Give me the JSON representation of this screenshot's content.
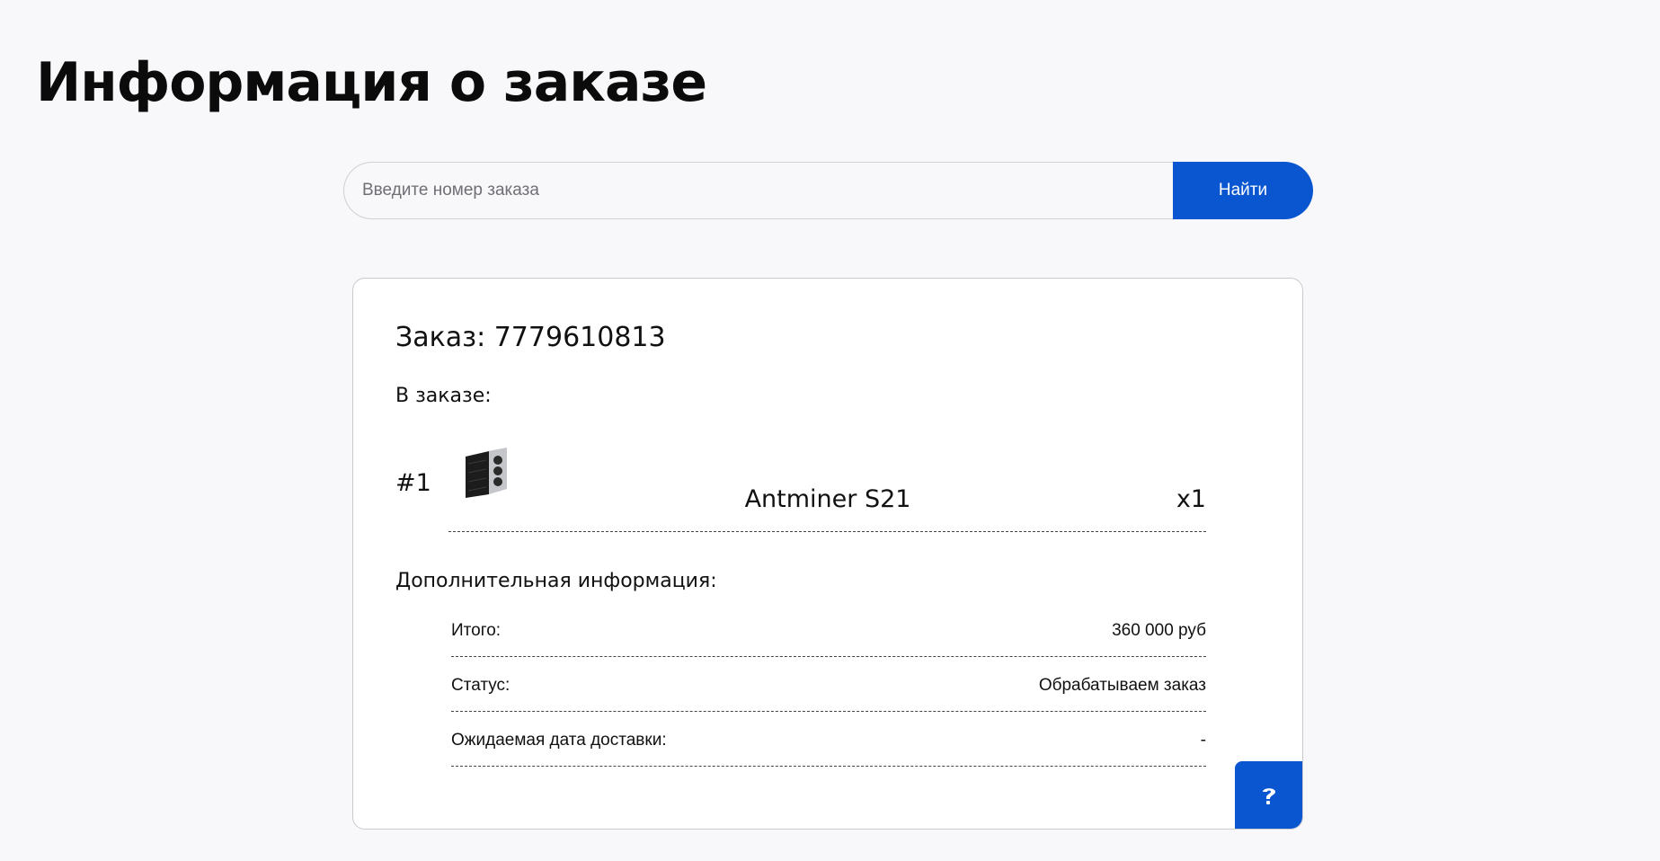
{
  "header": {
    "title": "Информация о заказе"
  },
  "search": {
    "placeholder": "Введите номер заказа",
    "value": "",
    "button_label": "Найти"
  },
  "order": {
    "heading": "Заказ: 7779610813",
    "items_label": "В заказе:",
    "items": [
      {
        "number": "#1",
        "name": "Antminer S21",
        "quantity": "x1",
        "image_icon": "asic-miner-product-image"
      }
    ],
    "additional_label": "Дополнительная информация:",
    "info": [
      {
        "label": "Итого:",
        "value": "360 000 руб"
      },
      {
        "label": "Статус:",
        "value": "Обрабатываем заказ"
      },
      {
        "label": "Ожидаемая дата доставки:",
        "value": "-"
      }
    ]
  },
  "help_widget": {
    "icon": "question-mark-icon"
  },
  "colors": {
    "accent": "#0a55d0",
    "background": "#f8f8fa",
    "card": "#ffffff"
  }
}
